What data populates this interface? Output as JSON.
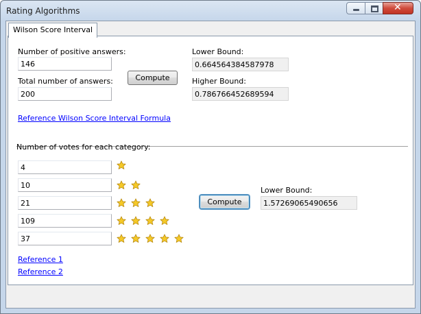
{
  "window": {
    "title": "Rating Algorithms"
  },
  "tabs": [
    {
      "label": "Wilson Score Interval"
    }
  ],
  "wilson": {
    "positive_label": "Number of positive answers:",
    "positive_value": "146",
    "total_label": "Total number of answers:",
    "total_value": "200",
    "compute_label": "Compute",
    "lower_label": "Lower Bound:",
    "lower_value": "0.664564384587978",
    "higher_label": "Higher Bound:",
    "higher_value": "0.786766452689594",
    "reference_link": "Reference Wilson Score Interval Formula"
  },
  "rating": {
    "votes_label": "Number of votes for each category:",
    "categories": [
      {
        "votes": "4",
        "stars": 1
      },
      {
        "votes": "10",
        "stars": 2
      },
      {
        "votes": "21",
        "stars": 3
      },
      {
        "votes": "109",
        "stars": 4
      },
      {
        "votes": "37",
        "stars": 5
      }
    ],
    "compute_label": "Compute",
    "lower_label": "Lower Bound:",
    "lower_value": "1.57269065490656",
    "reference1": "Reference 1",
    "reference2": "Reference 2"
  },
  "colors": {
    "star_fill": "#f5c928",
    "star_stroke": "#b88a12",
    "link": "#0000ff"
  },
  "icons": {
    "star": "star-icon"
  }
}
